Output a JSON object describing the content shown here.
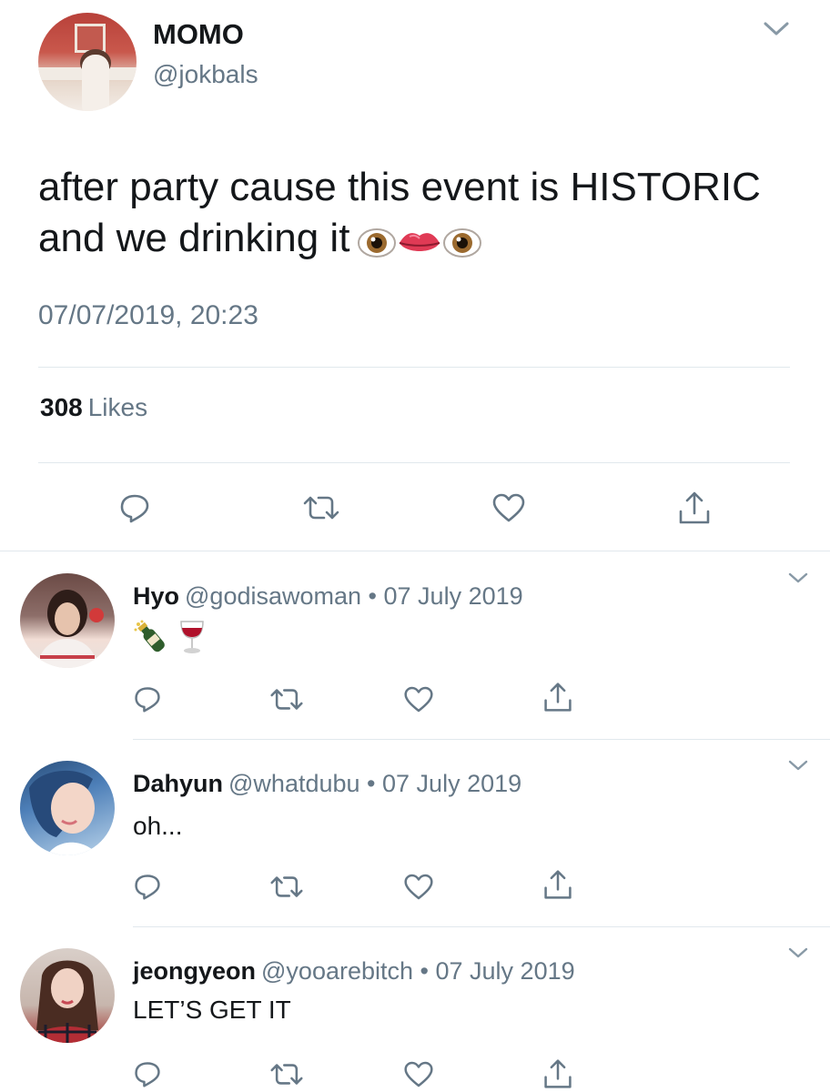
{
  "main_tweet": {
    "name": "MOMO",
    "handle": "@jokbals",
    "text": "after party cause this event is HISTORIC and we drinking it",
    "emojis": [
      "eyes-emoji",
      "lips-emoji",
      "eyes-emoji"
    ],
    "timestamp": "07/07/2019, 20:23",
    "likes_count": "308",
    "likes_label": "Likes"
  },
  "replies": [
    {
      "name": "Hyo",
      "handle": "@godisawoman",
      "separator": "•",
      "date": "07 July 2019",
      "text": "",
      "emojis": [
        "champagne-emoji",
        "wine-glass-emoji"
      ]
    },
    {
      "name": "Dahyun",
      "handle": "@whatdubu",
      "separator": "•",
      "date": "07 July 2019",
      "text": "oh...",
      "emojis": []
    },
    {
      "name": "jeongyeon",
      "handle": "@yooarebitch",
      "separator": "•",
      "date": "07 July 2019",
      "text": "LET’S GET IT",
      "emojis": []
    }
  ],
  "icons": {
    "reply": "reply-icon",
    "retweet": "retweet-icon",
    "like": "heart-icon",
    "share": "share-icon",
    "more": "chevron-down-icon"
  },
  "colors": {
    "text": "#14171a",
    "secondary": "#657786",
    "divider": "#e1e8ed"
  }
}
